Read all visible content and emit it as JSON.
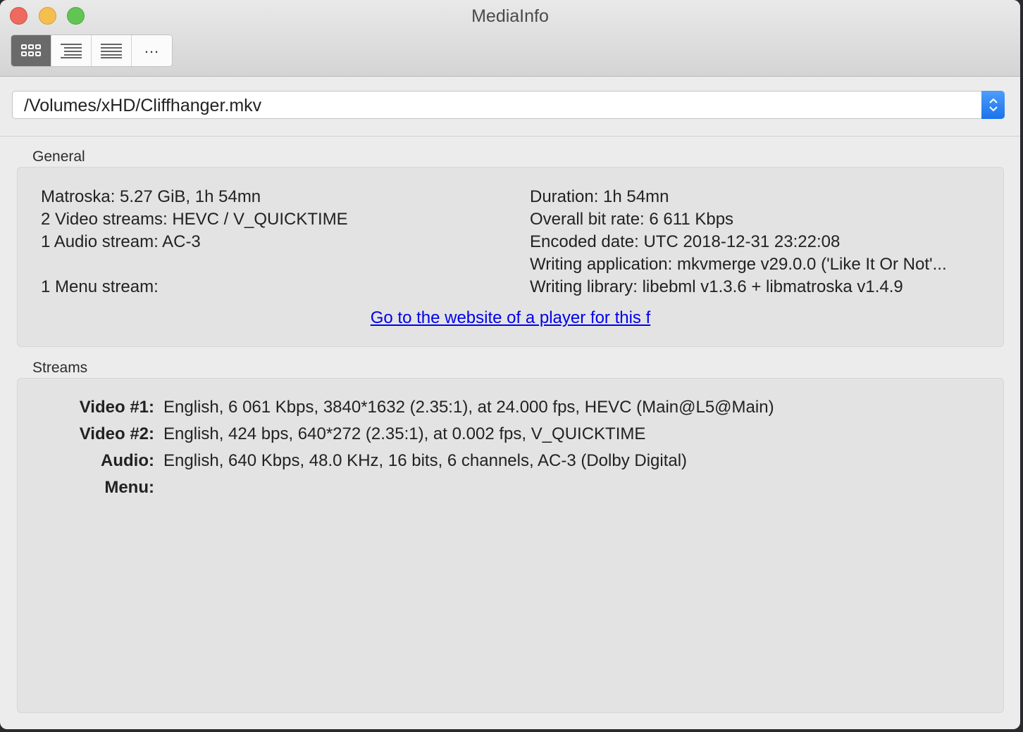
{
  "window": {
    "title": "MediaInfo"
  },
  "toolbar": {
    "buttons": [
      {
        "name": "basic-view-button",
        "icon": "grid-icon",
        "active": true
      },
      {
        "name": "sheet-view-button",
        "icon": "tree-list-icon",
        "active": false
      },
      {
        "name": "text-view-button",
        "icon": "lines-icon",
        "active": false
      },
      {
        "name": "more-views-button",
        "label": "...",
        "active": false
      }
    ]
  },
  "file": {
    "path": "/Volumes/xHD/Cliffhanger.mkv"
  },
  "general": {
    "title": "General",
    "left": [
      "Matroska: 5.27 GiB, 1h 54mn",
      "2 Video streams: HEVC / V_QUICKTIME",
      "1 Audio stream: AC-3",
      "",
      "1 Menu stream:"
    ],
    "right": [
      "Duration: 1h 54mn",
      "Overall bit rate: 6 611 Kbps",
      "Encoded date: UTC 2018-12-31 23:22:08",
      "Writing application: mkvmerge v29.0.0 ('Like It Or Not'...",
      "Writing library: libebml v1.3.6 + libmatroska v1.4.9"
    ],
    "link": "Go to the website of a player for this f"
  },
  "streams": {
    "title": "Streams",
    "rows": [
      {
        "label": "Video #1:",
        "value": "English, 6 061 Kbps, 3840*1632 (2.35:1), at 24.000 fps, HEVC (Main@L5@Main)"
      },
      {
        "label": "Video #2:",
        "value": "English, 424 bps, 640*272 (2.35:1), at 0.002 fps, V_QUICKTIME"
      },
      {
        "label": "Audio:",
        "value": "English, 640 Kbps, 48.0 KHz, 16 bits, 6 channels, AC-3 (Dolby Digital)"
      },
      {
        "label": "Menu:",
        "value": ""
      }
    ]
  }
}
